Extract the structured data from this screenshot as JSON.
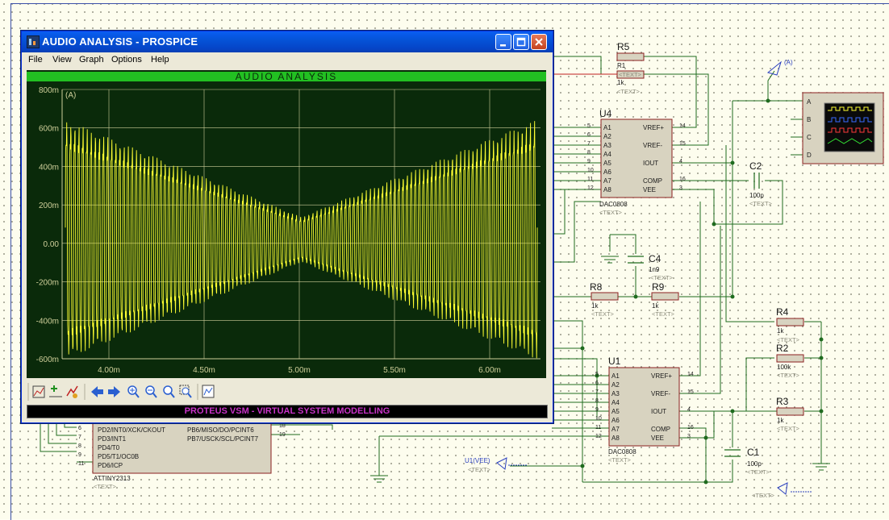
{
  "window": {
    "title": "AUDIO ANALYSIS - PROSPICE",
    "menu": [
      "File",
      "View",
      "Graph",
      "Options",
      "Help"
    ],
    "status": "PROTEUS VSM - VIRTUAL SYSTEM MODELLING",
    "toolbar_icons": [
      "graph-icon",
      "add-trace-icon",
      "simulate-icon",
      "arrow-left-icon",
      "arrow-right-icon",
      "zoom-in-icon",
      "zoom-out-icon",
      "zoom-all-icon",
      "zoom-area-icon",
      "header-icon"
    ]
  },
  "graph": {
    "header": "AUDIO ANALYSIS",
    "trace_label": "(A)",
    "y_ticks": [
      "800m",
      "600m",
      "400m",
      "200m",
      "0.00",
      "-200m",
      "-400m",
      "-600m"
    ],
    "x_ticks": [
      "4.00m",
      "4.50m",
      "5.00m",
      "5.50m",
      "6.00m"
    ],
    "colors": {
      "background": "#0a2a0a",
      "grid": "#cfcf9a",
      "trace": "#ffff33",
      "header": "#22c022"
    }
  },
  "schematic": {
    "components": {
      "r5": {
        "name": "R5",
        "value": "1k",
        "text": "<TEXT>",
        "overlay": "R1"
      },
      "r8": {
        "name": "R8",
        "value": "1k",
        "text": "<TEXT>"
      },
      "r9": {
        "name": "R9",
        "value": "1k",
        "text": "<TEXT>"
      },
      "r4": {
        "name": "R4",
        "value": "1k",
        "text": "<TEXT>"
      },
      "r2": {
        "name": "R2",
        "value": "100k",
        "text": "<TEXT>"
      },
      "r3": {
        "name": "R3",
        "value": "1k",
        "text": "<TEXT>"
      },
      "c2": {
        "name": "C2",
        "value": "100p",
        "text": "<TEXT>"
      },
      "c4": {
        "name": "C4",
        "value": "1n9",
        "text": "<TEXT>"
      },
      "c1": {
        "name": "C1",
        "value": "100p",
        "text": "<TEXT>"
      },
      "u4": {
        "name": "U4",
        "part": "DAC0808",
        "text": "<TEXT>"
      },
      "u1": {
        "name": "U1",
        "part": "DAC0808",
        "text": "<TEXT>"
      },
      "mcu": {
        "part": "ATTINY2313",
        "text": "<TEXT>"
      }
    },
    "dac_left_pins": [
      "A1",
      "A2",
      "A3",
      "A4",
      "A5",
      "A6",
      "A7",
      "A8"
    ],
    "dac_left_nums": [
      "5",
      "6",
      "7",
      "8",
      "9",
      "10",
      "11",
      "12"
    ],
    "dac_right_pins": [
      "VREF+",
      "VREF-",
      "IOUT",
      "COMP",
      "VEE"
    ],
    "dac_right_nums": [
      "14",
      "15",
      "4",
      "16",
      "3"
    ],
    "mcu_pins": [
      {
        "num": "6",
        "name": "PD2/INT0/XCK/CKOUT"
      },
      {
        "num": "7",
        "name": "PD3/INT1"
      },
      {
        "num": "8",
        "name": "PD4/T0"
      },
      {
        "num": "9",
        "name": "PD5/T1/OC0B"
      },
      {
        "num": "11",
        "name": "PD6/ICP"
      }
    ],
    "mcu_right_pins": [
      {
        "num": "18",
        "name": "PB6/MISO/DO/PCINT6"
      },
      {
        "num": "19",
        "name": "PB7/USCK/SCL/PCINT7"
      }
    ],
    "probe_a": "(A)",
    "probe_u1": "U1(VEE)",
    "probe_text": "<TEXT>",
    "probe_text2": "<TEXT>",
    "scope_channels": [
      "A",
      "B",
      "C",
      "D"
    ]
  }
}
